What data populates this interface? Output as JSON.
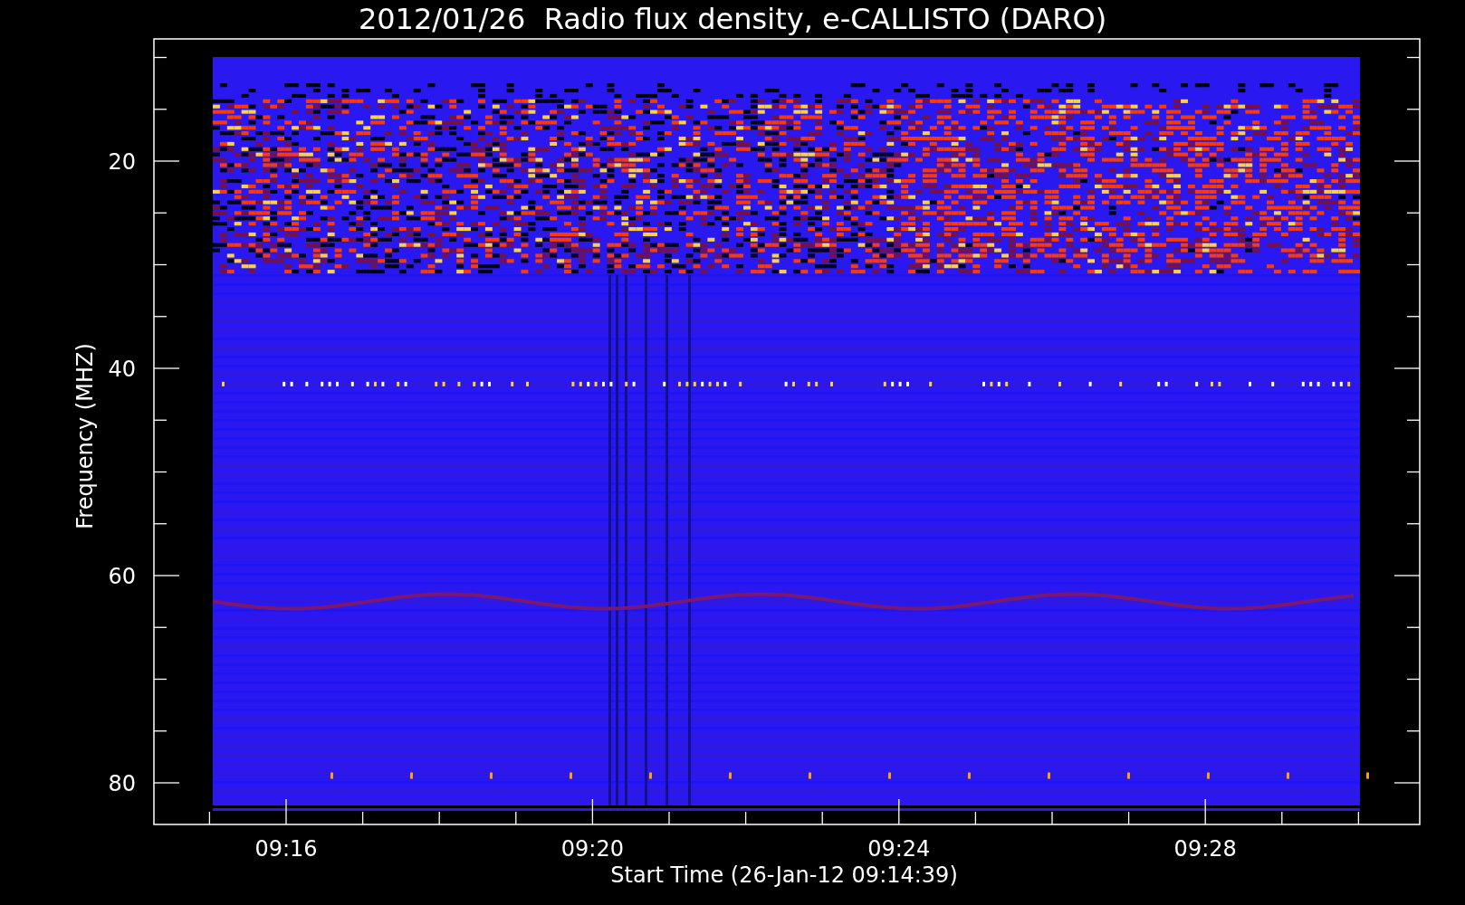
{
  "title": "2012/01/26  Radio flux density, e-CALLISTO (DARO)",
  "y_axis": {
    "label": "Frequency (MHZ)",
    "ticks": [
      "20",
      "40",
      "60",
      "80"
    ]
  },
  "x_axis": {
    "label": "Start Time (26-Jan-12 09:14:39)",
    "ticks": [
      "09:16",
      "09:20",
      "09:24",
      "09:28"
    ]
  }
}
